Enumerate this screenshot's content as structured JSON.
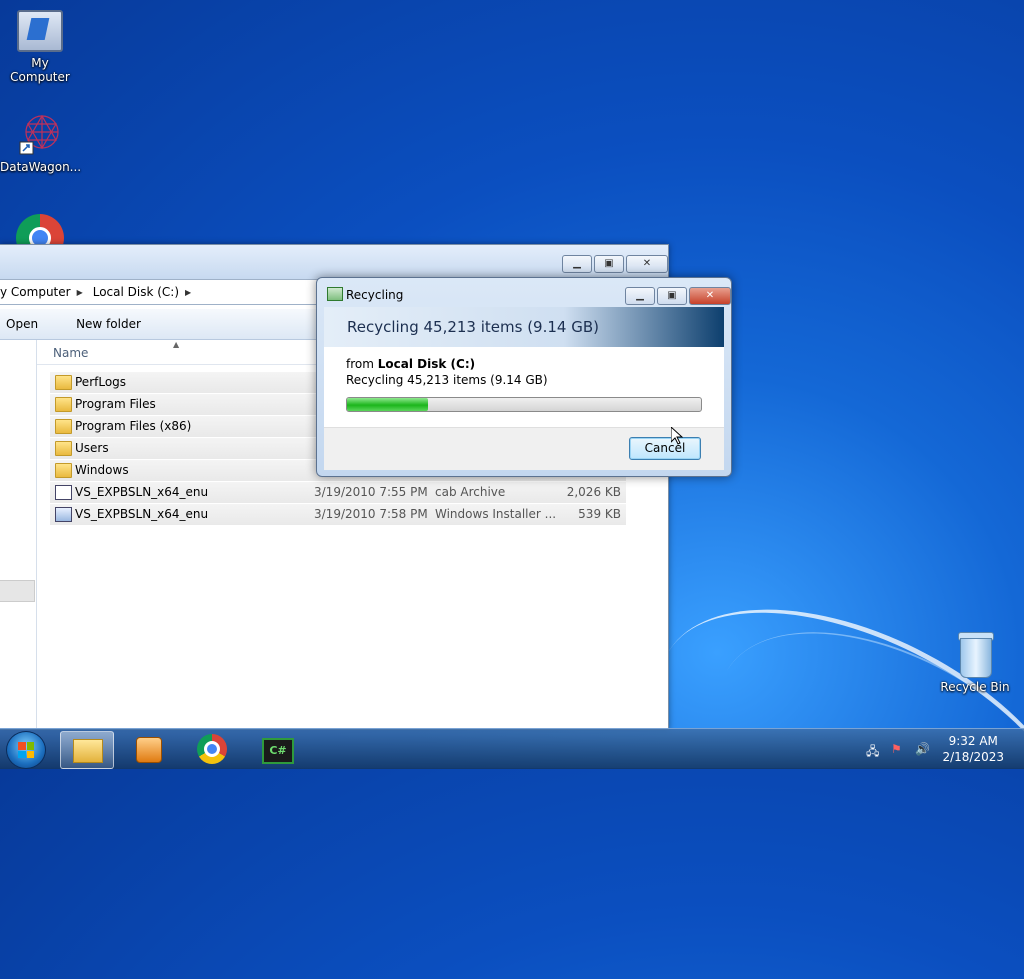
{
  "desktop": {
    "icons": [
      {
        "label": "My Computer"
      },
      {
        "label": "DataWagon..."
      },
      {
        "label": ""
      },
      {
        "label": "Recycle Bin"
      }
    ]
  },
  "explorer": {
    "breadcrumb": [
      "y Computer",
      "Local Disk (C:)"
    ],
    "toolbar": {
      "open": "Open",
      "new_folder": "New folder"
    },
    "columns": {
      "name": "Name"
    },
    "files": [
      {
        "name": "PerfLogs",
        "date": "",
        "type": "",
        "size": "",
        "icon": "folder-icon"
      },
      {
        "name": "Program Files",
        "date": "",
        "type": "",
        "size": "",
        "icon": "folder-icon"
      },
      {
        "name": "Program Files (x86)",
        "date": "",
        "type": "",
        "size": "",
        "icon": "folder-icon"
      },
      {
        "name": "Users",
        "date": "",
        "type": "",
        "size": "",
        "icon": "folder-icon"
      },
      {
        "name": "Windows",
        "date": "",
        "type": "",
        "size": "",
        "icon": "folder-icon"
      },
      {
        "name": "VS_EXPBSLN_x64_enu",
        "date": "3/19/2010 7:55 PM",
        "type": "cab Archive",
        "size": "2,026 KB",
        "icon": "cab-file-icon"
      },
      {
        "name": "VS_EXPBSLN_x64_enu",
        "date": "3/19/2010 7:58 PM",
        "type": "Windows Installer ...",
        "size": "539 KB",
        "icon": "installer-file-icon"
      }
    ]
  },
  "dialog": {
    "title": "Recycling",
    "header": "Recycling 45,213 items (9.14 GB)",
    "from_prefix": "from",
    "from_location": "Local Disk (C:)",
    "detail": "Recycling 45,213 items (9.14 GB)",
    "progress": 0.23,
    "cancel": "Cancel"
  },
  "taskbar": {
    "apps": [
      "windows-explorer",
      "windows-media-player",
      "google-chrome",
      "csharp-editor"
    ],
    "cs_label": "C#",
    "time": "9:32 AM",
    "date": "2/18/2023"
  }
}
